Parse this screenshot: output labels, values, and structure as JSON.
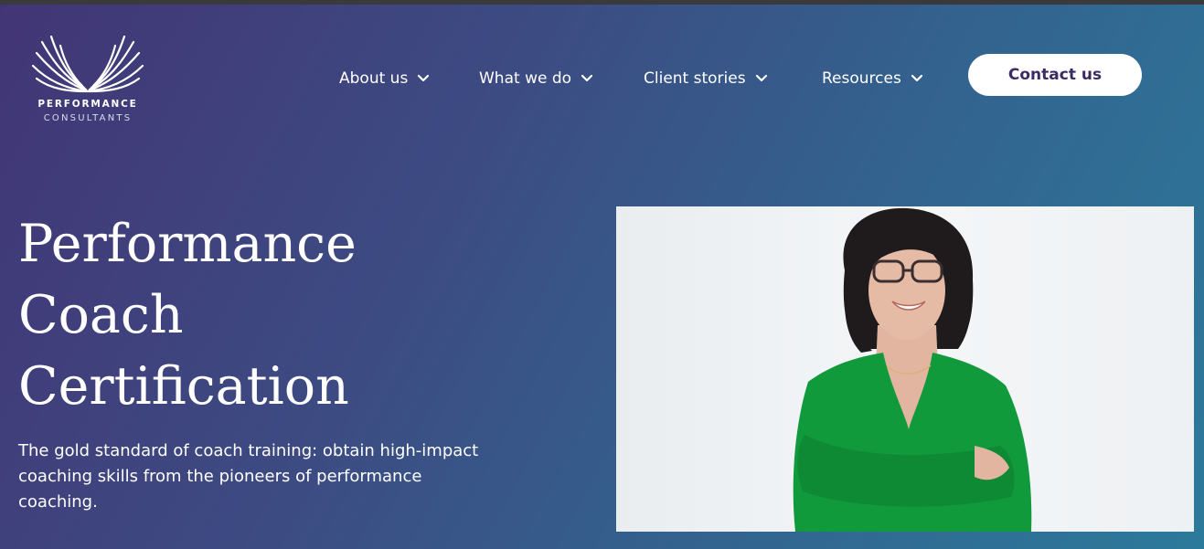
{
  "logo": {
    "name_line1": "PERFORMANCE",
    "name_line2": "CONSULTANTS",
    "icon": "wings-icon"
  },
  "nav": {
    "items": [
      {
        "label": "About us",
        "icon": "chevron-down-icon"
      },
      {
        "label": "What we do",
        "icon": "chevron-down-icon"
      },
      {
        "label": "Client stories",
        "icon": "chevron-down-icon"
      },
      {
        "label": "Resources",
        "icon": "chevron-down-icon"
      }
    ],
    "cta_label": "Contact us"
  },
  "hero": {
    "title_lines": [
      "Performance",
      "Coach",
      "Certification"
    ],
    "subtitle": "The gold standard of coach training: obtain high-impact coaching skills from the pioneers of performance coaching."
  },
  "colors": {
    "gradient_start": "#423575",
    "gradient_end": "#2c7a9b",
    "cta_text": "#3b2b63",
    "cta_background": "#ffffff",
    "shirt_green": "#119a3c"
  }
}
